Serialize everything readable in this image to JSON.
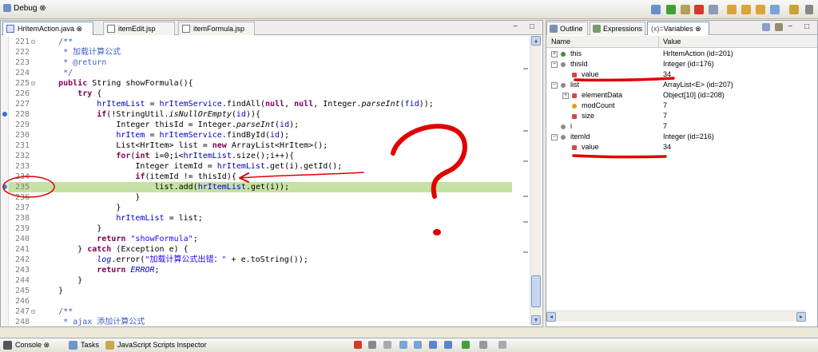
{
  "perspective": {
    "title": "Debug",
    "close": "⊗"
  },
  "editor": {
    "tabs": [
      {
        "label": "HrItemAction.java",
        "close": "⊗"
      },
      {
        "label": "itemEdit.jsp"
      },
      {
        "label": "itemFormula.jsp"
      }
    ],
    "window_controls": "− □",
    "lines": [
      {
        "n": "221",
        "fold": "⊟",
        "html": "    <span class=\"cm\">/**</span>"
      },
      {
        "n": "222",
        "html": "     <span class=\"cm\">* 加载计算公式</span>"
      },
      {
        "n": "223",
        "html": "     <span class=\"cm\">* @return</span>"
      },
      {
        "n": "224",
        "html": "     <span class=\"cm\">*/</span>"
      },
      {
        "n": "225",
        "fold": "⊟",
        "html": "    <span class=\"kw\">public</span> String showFormula(){"
      },
      {
        "n": "226",
        "html": "        <span class=\"kw\">try</span> {"
      },
      {
        "n": "227",
        "html": "            <span class=\"fld\">hrItemList</span> = <span class=\"fld\">hrItemService</span>.findAll(<span class=\"kw\">null</span>, <span class=\"kw\">null</span>, Integer.<span class=\"ital\">parseInt</span>(<span class=\"fld\">fid</span>));"
      },
      {
        "n": "228",
        "html": "            <span class=\"kw\">if</span>(!StringUtil.<span class=\"ital\">isNullOrEmpty</span>(<span class=\"fld\">id</span>)){"
      },
      {
        "n": "229",
        "html": "                Integer thisId = Integer.<span class=\"ital\">parseInt</span>(<span class=\"fld\">id</span>);"
      },
      {
        "n": "230",
        "html": "                <span class=\"fld\">hrItem</span> = <span class=\"fld\">hrItemService</span>.findById(<span class=\"fld\">id</span>);"
      },
      {
        "n": "231",
        "html": "                List&lt;HrItem&gt; list = <span class=\"kw\">new</span> ArrayList&lt;HrItem&gt;();"
      },
      {
        "n": "232",
        "html": "                <span class=\"kw\">for</span>(<span class=\"kw\">int</span> i=0;i&lt;<span class=\"fld\">hrItemList</span>.size();i++){"
      },
      {
        "n": "233",
        "html": "                    Integer itemId = <span class=\"fld\">hrItemList</span>.get(i).getId();"
      },
      {
        "n": "234",
        "html": "                    <span class=\"kw\">if</span>(itemId != thisId){"
      },
      {
        "n": "235",
        "hl": true,
        "html": "                        list.add(<span class=\"fld\">hrItemList</span>.get(i));"
      },
      {
        "n": "236",
        "html": "                    }"
      },
      {
        "n": "237",
        "html": "                }"
      },
      {
        "n": "238",
        "html": "                <span class=\"fld\">hrItemList</span> = list;"
      },
      {
        "n": "239",
        "html": "            }"
      },
      {
        "n": "240",
        "html": "            <span class=\"kw\">return</span> <span class=\"str\">\"showFormula\"</span>;"
      },
      {
        "n": "241",
        "html": "        } <span class=\"kw\">catch</span> (Exception e) {"
      },
      {
        "n": "242",
        "html": "            <span class=\"fld ital\">log</span>.error(<span class=\"str\">\"加载计算公式出错：\"</span> + e.toString());"
      },
      {
        "n": "243",
        "html": "            <span class=\"kw\">return</span> <span class=\"fld ital\">ERROR</span>;"
      },
      {
        "n": "244",
        "html": "        }"
      },
      {
        "n": "245",
        "html": "    }"
      },
      {
        "n": "246",
        "html": ""
      },
      {
        "n": "247",
        "fold": "⊟",
        "html": "    <span class=\"cm\">/**</span>"
      },
      {
        "n": "248",
        "html": "     <span class=\"cm\">* ajax 添加计算公式</span>"
      }
    ]
  },
  "right_panel": {
    "tabs": [
      {
        "label": "Outline"
      },
      {
        "label": "Expressions"
      },
      {
        "label": "Variables",
        "prefix": "(x)=",
        "close": "⊗"
      }
    ],
    "window_controls": "− □",
    "header": {
      "name": "Name",
      "value": "Value"
    },
    "rows": [
      {
        "name": "this",
        "value": "HrItemAction  (id=201)",
        "exp": "+",
        "icon": "green"
      },
      {
        "name": "thisId",
        "value": "Integer  (id=176)",
        "exp": "−",
        "icon": "gray"
      },
      {
        "name": "value",
        "value": "34",
        "icon": "field"
      },
      {
        "name": "list",
        "value": "ArrayList<E>  (id=207)",
        "exp": "−",
        "icon": "gray"
      },
      {
        "name": "elementData",
        "value": "Object[10]  (id=208)",
        "exp": "+",
        "icon": "field"
      },
      {
        "name": "modCount",
        "value": "7",
        "icon": "diamond"
      },
      {
        "name": "size",
        "value": "7",
        "icon": "field"
      },
      {
        "name": "i",
        "value": "7",
        "icon": "gray"
      },
      {
        "name": "itemId",
        "value": "Integer  (id=216)",
        "exp": "−",
        "icon": "gray"
      },
      {
        "name": "value",
        "value": "34",
        "icon": "field"
      }
    ]
  },
  "bottom": {
    "tabs": [
      {
        "label": "Console",
        "close": "⊗"
      },
      {
        "label": "Tasks"
      },
      {
        "label": "JavaScript Scripts Inspector"
      }
    ]
  },
  "colors": {
    "highlight": "#c6e1a3",
    "annotation": "#e00000",
    "keyword": "#7f0055",
    "field": "#0000c0",
    "string": "#2a00ff",
    "comment": "#3f5fbf"
  }
}
